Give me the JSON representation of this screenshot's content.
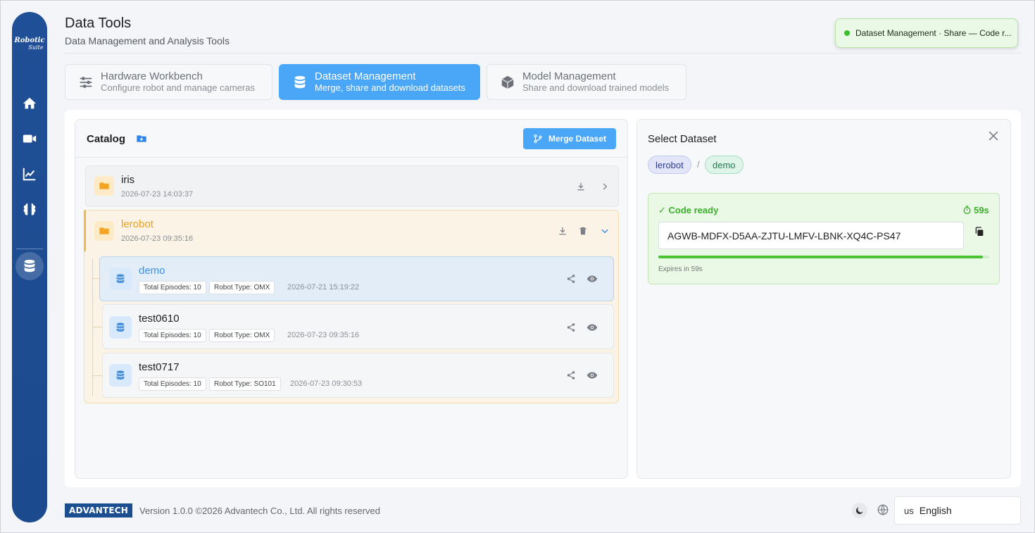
{
  "logo": {
    "line1": "Robotic",
    "line2": "Suite"
  },
  "header": {
    "title": "Data Tools",
    "subtitle": "Data Management and Analysis Tools"
  },
  "toast": {
    "text": "Dataset Management · Share — Code r..."
  },
  "tabs": [
    {
      "title": "Hardware Workbench",
      "subtitle": "Configure robot and manage cameras",
      "icon": "sliders-icon",
      "active": false
    },
    {
      "title": "Dataset Management",
      "subtitle": "Merge, share and download datasets",
      "icon": "database-icon",
      "active": true
    },
    {
      "title": "Model Management",
      "subtitle": "Share and download trained models",
      "icon": "cube-icon",
      "active": false
    }
  ],
  "catalog": {
    "title": "Catalog",
    "merge_label": "Merge Dataset",
    "folders": [
      {
        "name": "iris",
        "date": "2026-07-23 14:03:37",
        "expanded": false
      },
      {
        "name": "lerobot",
        "date": "2026-07-23 09:35:16",
        "expanded": true,
        "datasets": [
          {
            "name": "demo",
            "episodes": "Total Episodes: 10",
            "robot": "Robot Type: OMX",
            "date": "2026-07-21 15:19:22",
            "selected": true
          },
          {
            "name": "test0610",
            "episodes": "Total Episodes: 10",
            "robot": "Robot Type: OMX",
            "date": "2026-07-23 09:35:16",
            "selected": false
          },
          {
            "name": "test0717",
            "episodes": "Total Episodes: 10",
            "robot": "Robot Type: SO101",
            "date": "2026-07-23 09:30:53",
            "selected": false
          }
        ]
      }
    ]
  },
  "detail": {
    "title": "Select Dataset",
    "crumb_folder": "lerobot",
    "crumb_sep": "/",
    "crumb_dataset": "demo",
    "code_ready": "✓ Code ready",
    "timer": "59s",
    "code": "AGWB-MDFX-D5AA-ZJTU-LMFV-LBNK-XQ4C-PS47",
    "expires": "Expires in 59s",
    "progress": 0.98
  },
  "footer": {
    "brand": "ADVANTECH",
    "version": "Version 1.0.0 ©2026 Advantech Co., Ltd. All rights reserved",
    "lang_flag": "us",
    "lang": "English"
  },
  "colors": {
    "accent": "#4aa7f8",
    "sidebar": "#1f4f96",
    "success": "#3bae2a",
    "folder": "#f5a524"
  }
}
